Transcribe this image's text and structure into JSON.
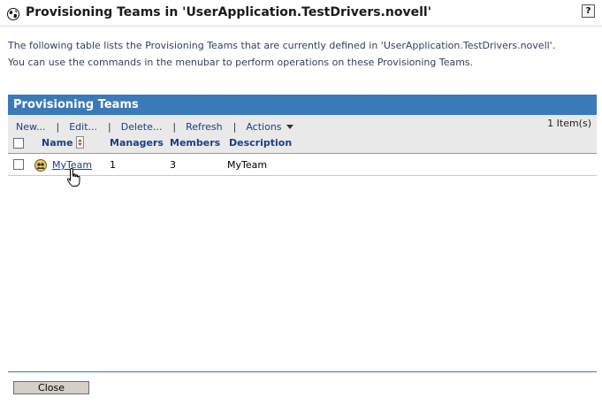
{
  "header": {
    "title": "Provisioning Teams in 'UserApplication.TestDrivers.novell'",
    "help_label": "?"
  },
  "description": {
    "line1": "The following table lists the Provisioning Teams that are currently defined in 'UserApplication.TestDrivers.novell'.",
    "line2": "You can use the commands in the menubar to perform operations on these Provisioning Teams."
  },
  "panel": {
    "title": "Provisioning Teams",
    "item_count": "1 Item(s)"
  },
  "menu": {
    "new": "New...",
    "edit": "Edit...",
    "delete": "Delete...",
    "refresh": "Refresh",
    "actions": "Actions",
    "separator": "|"
  },
  "columns": {
    "name": "Name",
    "managers": "Managers",
    "members": "Members",
    "description": "Description"
  },
  "rows": [
    {
      "name": "MyTeam",
      "managers": "1",
      "members": "3",
      "description": "MyTeam"
    }
  ],
  "footer": {
    "close_label": "Close"
  },
  "colors": {
    "panel_header": "#3a7ab8",
    "link": "#1a3f85",
    "toolbar_bg": "#e9e9e9"
  }
}
